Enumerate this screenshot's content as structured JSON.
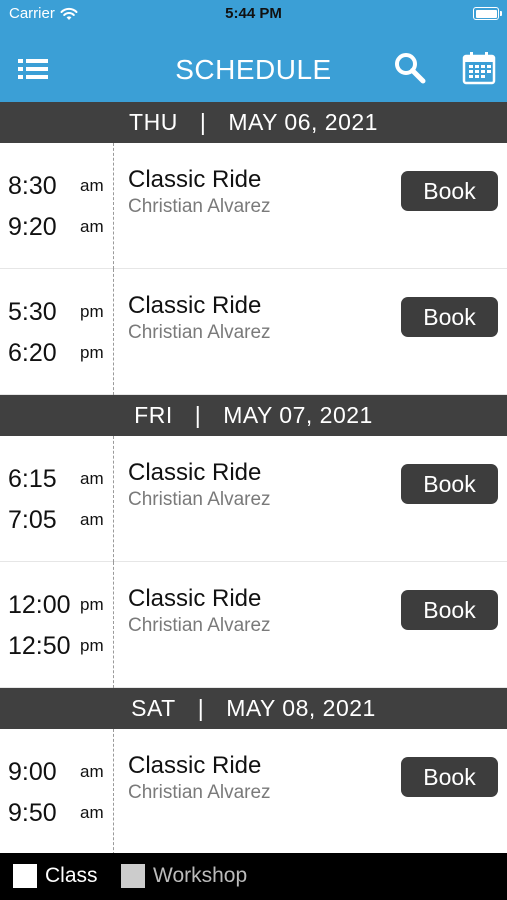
{
  "status_bar": {
    "carrier": "Carrier",
    "time": "5:44 PM"
  },
  "nav": {
    "title": "SCHEDULE",
    "icons": [
      "list-icon",
      "search-icon",
      "calendar-icon"
    ]
  },
  "days": [
    {
      "weekday": "THU",
      "separator": "|",
      "date": "MAY 06, 2021",
      "sessions": [
        {
          "start": "8:30",
          "start_period": "am",
          "end": "9:20",
          "end_period": "am",
          "class": "Classic Ride",
          "instructor": "Christian Alvarez",
          "action": "Book"
        },
        {
          "start": "5:30",
          "start_period": "pm",
          "end": "6:20",
          "end_period": "pm",
          "class": "Classic Ride",
          "instructor": "Christian Alvarez",
          "action": "Book"
        }
      ]
    },
    {
      "weekday": "FRI",
      "separator": "|",
      "date": "MAY 07, 2021",
      "sessions": [
        {
          "start": "6:15",
          "start_period": "am",
          "end": "7:05",
          "end_period": "am",
          "class": "Classic Ride",
          "instructor": "Christian Alvarez",
          "action": "Book"
        },
        {
          "start": "12:00",
          "start_period": "pm",
          "end": "12:50",
          "end_period": "pm",
          "class": "Classic Ride",
          "instructor": "Christian Alvarez",
          "action": "Book"
        }
      ]
    },
    {
      "weekday": "SAT",
      "separator": "|",
      "date": "MAY 08, 2021",
      "sessions": [
        {
          "start": "9:00",
          "start_period": "am",
          "end": "9:50",
          "end_period": "am",
          "class": "Classic Ride",
          "instructor": "Christian Alvarez",
          "action": "Book"
        }
      ]
    }
  ],
  "legend": [
    {
      "label": "Class",
      "color": "#ffffff"
    },
    {
      "label": "Workshop",
      "color": "#cccccc"
    }
  ],
  "colors": {
    "accent": "#3b9fd6",
    "header": "#404040",
    "button": "#3d3d3d"
  }
}
